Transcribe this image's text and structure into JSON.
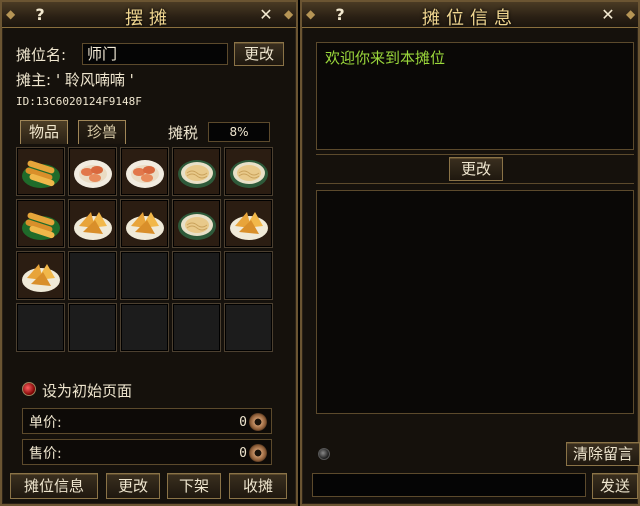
{
  "left": {
    "title": "摆摊",
    "help": "?",
    "close": "✕",
    "stall_name_label": "摊位名:",
    "stall_name_value": "师门",
    "change_button": "更改",
    "owner_label": "摊主:",
    "owner_value": "' 聆风喃喃 '",
    "id_text": "ID:13C6020124F9148F",
    "tabs": [
      "物品",
      "珍兽"
    ],
    "tax_label": "摊税",
    "tax_value": "8%",
    "items": [
      "spring-roll",
      "sausage-plate",
      "sausage-plate",
      "noodle-plate",
      "noodle-plate",
      "spring-roll",
      "pancake-plate",
      "pancake-plate",
      "noodle-plate",
      "pancake-plate",
      "pancake-plate",
      "",
      "",
      "",
      "",
      "",
      "",
      "",
      "",
      ""
    ],
    "homepage_label": "设为初始页面",
    "unit_price_label": "单价:",
    "unit_price_value": "0",
    "sale_price_label": "售价:",
    "sale_price_value": "0",
    "bottom_buttons": [
      "摊位信息",
      "更改",
      "下架",
      "收摊"
    ]
  },
  "right": {
    "title": "摊位信息",
    "help": "?",
    "close": "✕",
    "welcome_message": "欢迎你来到本摊位",
    "change_button": "更改",
    "clear_button": "清除留言",
    "send_button": "发送"
  },
  "colors": {
    "gold_text": "#f0d690",
    "message_green": "#9bd83b",
    "border_bronze": "#8a7347"
  }
}
